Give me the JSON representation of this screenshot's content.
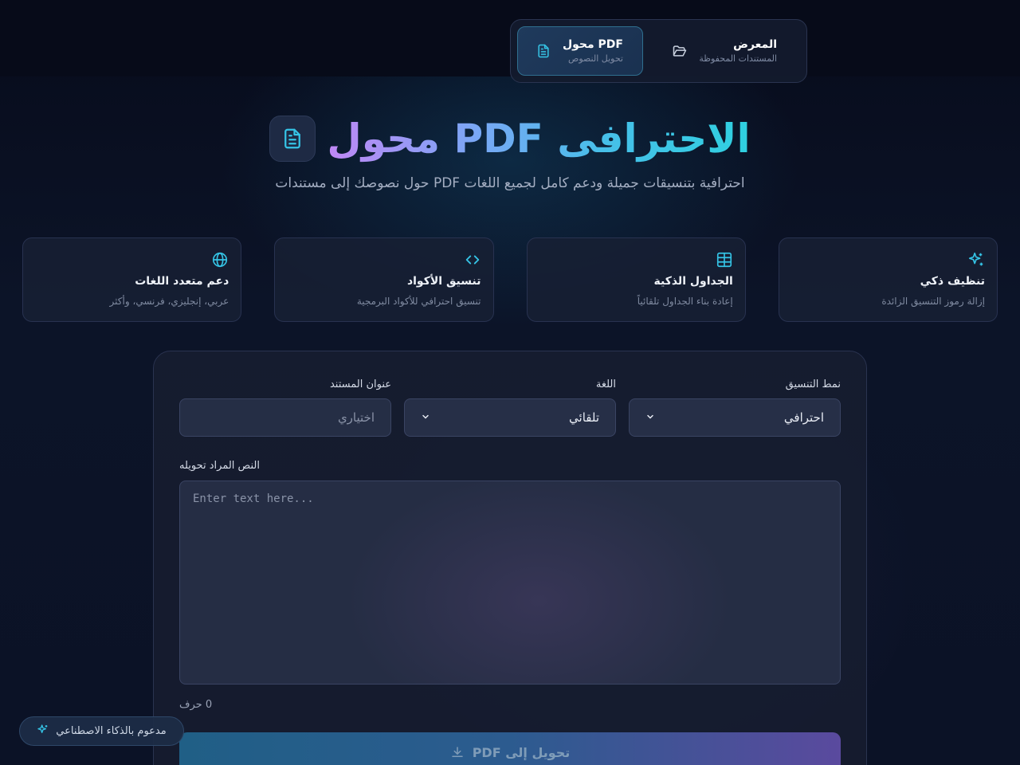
{
  "nav": {
    "active": {
      "title": "محول PDF",
      "subtitle": "تحويل النصوص"
    },
    "inactive": {
      "title": "المعرض",
      "subtitle": "المستندات المحفوظة"
    }
  },
  "hero": {
    "title": "الاحترافى PDF محول",
    "subtitle": "احترافية بتنسيقات جميلة ودعم كامل لجميع اللغات PDF حول نصوصك إلى مستندات"
  },
  "features": [
    {
      "title": "تنظيف ذكي",
      "desc": "إزالة رموز التنسيق الزائدة",
      "icon": "sparkles-icon"
    },
    {
      "title": "الجداول الذكية",
      "desc": "إعادة بناء الجداول تلقائياً",
      "icon": "table-icon"
    },
    {
      "title": "تنسيق الأكواد",
      "desc": "تنسيق احترافي للأكواد البرمجية",
      "icon": "code-icon"
    },
    {
      "title": "دعم متعدد اللغات",
      "desc": "عربي، إنجليزي، فرنسي، وأكثر",
      "icon": "globe-icon"
    }
  ],
  "form": {
    "style_label": "نمط التنسيق",
    "style_value": "احترافي",
    "language_label": "اللغة",
    "language_value": "تلقائي",
    "title_label": "عنوان المستند",
    "title_placeholder": "اختياري",
    "text_label": "النص المراد تحويله",
    "text_placeholder": "Enter text here...",
    "char_count": "0 حرف",
    "convert_label": "تحويل إلى PDF"
  },
  "badge": {
    "label": "مدعوم بالذكاء الاصطناعي"
  },
  "colors": {
    "accent": "#2fd0e0",
    "purple": "#c087f5"
  }
}
